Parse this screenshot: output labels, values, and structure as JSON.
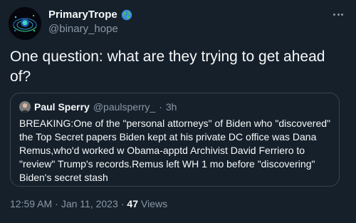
{
  "author": {
    "display_name": "PrimaryTrope",
    "handle": "@binary_hope",
    "badge_icon": "globe-icon"
  },
  "tweet": {
    "text": "One question: what are they trying to get ahead of?"
  },
  "quoted_tweet": {
    "display_name": "Paul Sperry",
    "handle": "@paulsperry_",
    "separator": "·",
    "time": "3h",
    "text": "BREAKING:One of the \"personal attorneys\" of Biden who \"discovered\" the Top Secret papers Biden kept at his private DC office was Dana Remus,who'd worked w Obama-apptd Archivist David Ferriero to \"review\" Trump's records.Remus left WH 1 mo before \"discovering\" Biden's secret stash"
  },
  "meta": {
    "time": "12:59 AM",
    "sep1": "·",
    "date": "Jan 11, 2023",
    "sep2": "·",
    "views_count": "47",
    "views_label": "Views"
  },
  "colors": {
    "background": "#15202b",
    "text": "#f7f9f9",
    "secondary": "#8b98a5",
    "border": "#38444d"
  }
}
